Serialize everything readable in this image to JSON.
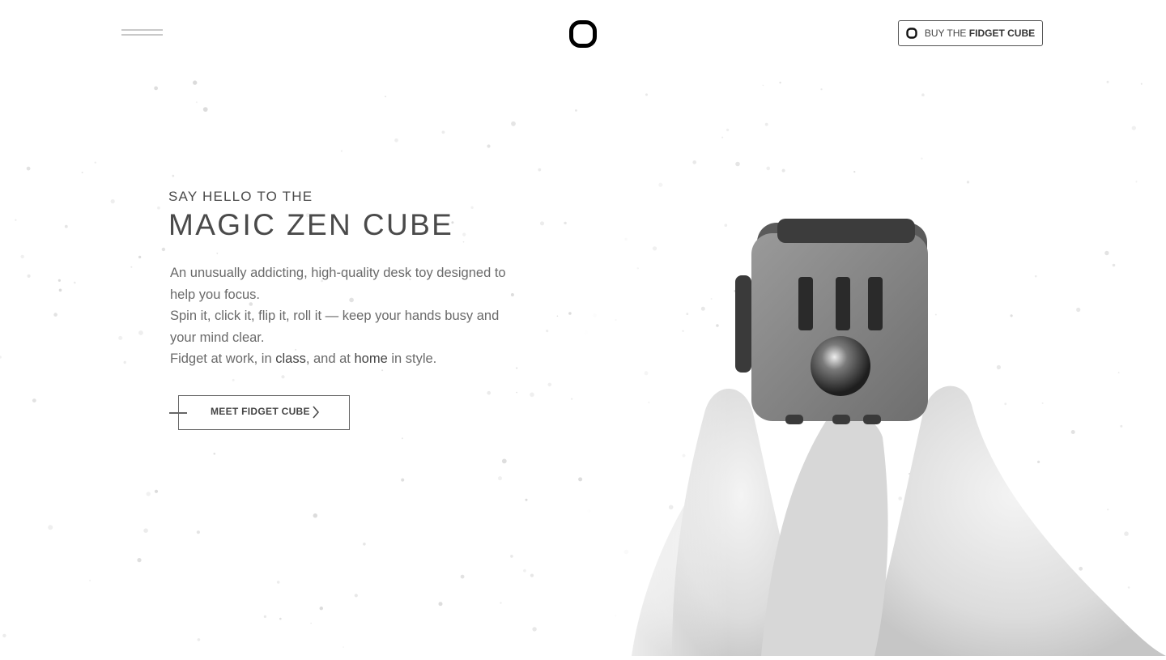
{
  "header": {
    "menu_icon": "hamburger-icon",
    "logo_icon": "rounded-square-logo-icon",
    "buy_button": {
      "icon": "rounded-square-mini-icon",
      "prefix": "BUY THE",
      "emphasis": "FIDGET CUBE"
    }
  },
  "hero": {
    "eyebrow": "SAY HELLO TO THE",
    "headline": "MAGIC ZEN CUBE",
    "description": {
      "line1": "An unusually addicting, high-quality desk toy designed to help you focus.",
      "line2": "Spin it, click it, flip it, roll it — keep your hands busy and your mind clear.",
      "line3_prefix": "Fidget at work, in ",
      "line3_class": "class",
      "line3_mid": ", and at ",
      "line3_home": "home",
      "line3_suffix": " in style."
    },
    "cta_label": "MEET FIDGET CUBE",
    "cta_icon": "chevron-right-icon",
    "image": "hand-holding-fidget-cube-photo"
  },
  "colors": {
    "background": "#ffffff",
    "text": "#4a4a4a",
    "body_text": "#6a6a6a",
    "border": "#555555"
  }
}
